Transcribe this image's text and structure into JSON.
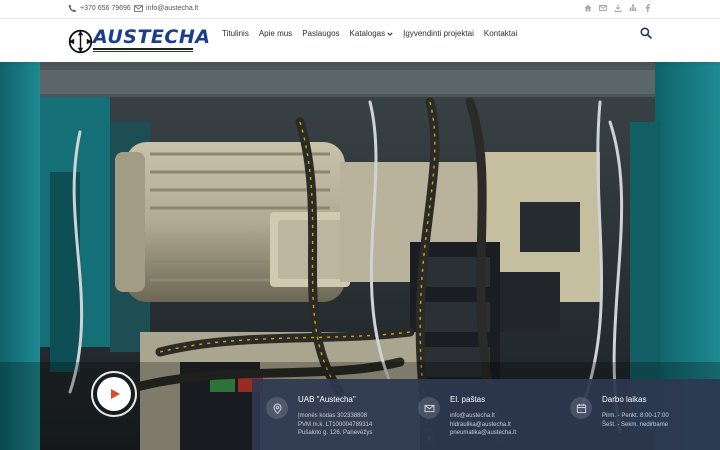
{
  "topbar": {
    "phone": "+370 656 79696",
    "email": "info@austecha.lt",
    "social_icons": [
      "home-icon",
      "envelope-icon",
      "download-icon",
      "sitemap-icon",
      "facebook-icon"
    ]
  },
  "header": {
    "logo_text": "AUSTECHA",
    "nav": [
      {
        "label": "Titulinis"
      },
      {
        "label": "Apie mus"
      },
      {
        "label": "Paslaugos"
      },
      {
        "label": "Katalogas"
      },
      {
        "label": "Įgyvendinti projektai"
      },
      {
        "label": "Kontaktai"
      }
    ],
    "search_icon": "search-icon"
  },
  "hero": {
    "play_icon": "play-icon",
    "accent_color": "#d94a2b"
  },
  "info": {
    "company": {
      "icon": "map-pin-icon",
      "title": "UAB \"Austecha\"",
      "lines": [
        "Įmonės kodas 302338808",
        "PVM m.k. LT100004789314",
        "Pušaloto g. 126, Panevėžys"
      ]
    },
    "email": {
      "icon": "envelope-icon",
      "title": "El. paštas",
      "lines": [
        "info@austecha.lt",
        "hidraulika@austecha.lt",
        "pneumatika@austecha.lt"
      ]
    },
    "hours": {
      "icon": "calendar-icon",
      "title": "Darbo laikas",
      "lines": [
        "Pirm. - Penkt. 8:00-17:00",
        "Šešt. - Sekm. nedirbame"
      ]
    }
  },
  "colors": {
    "brand_blue": "#1a3e8c",
    "info_bar": "#2e3850"
  }
}
